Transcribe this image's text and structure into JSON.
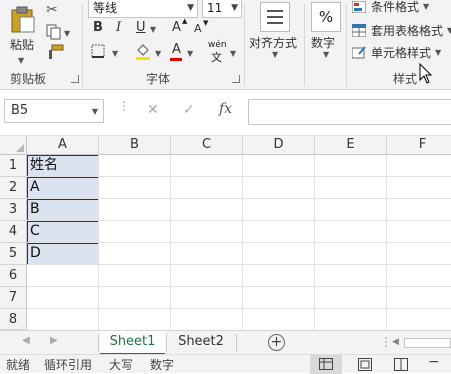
{
  "clipboard": {
    "paste_label": "粘贴",
    "group_label": "剪贴板"
  },
  "font": {
    "font_name": "等线",
    "font_size": "11",
    "bold": "B",
    "italic": "I",
    "underline": "U",
    "grow": "A",
    "shrink": "A",
    "color_a": "A",
    "wen": "wén",
    "wen2": "文",
    "group_label": "字体"
  },
  "alignment": {
    "label": "对齐方式"
  },
  "number": {
    "label": "数字",
    "percent": "%"
  },
  "styles": {
    "conditional": "条件格式",
    "table_format": "套用表格格式",
    "cell_style": "单元格样式",
    "group_label": "样式"
  },
  "formula_bar": {
    "name_box": "B5",
    "fx": "fx",
    "cancel": "✕",
    "enter": "✓"
  },
  "columns": [
    "A",
    "B",
    "C",
    "D",
    "E",
    "F"
  ],
  "rows": [
    "1",
    "2",
    "3",
    "4",
    "5",
    "6",
    "7",
    "8"
  ],
  "cells": {
    "A1": "姓名",
    "A2": "A",
    "A3": "B",
    "A4": "C",
    "A5": "D"
  },
  "sheets": [
    "Sheet1",
    "Sheet2"
  ],
  "status": {
    "ready": "就绪",
    "circular": "循环引用",
    "caps": "大写",
    "num": "数字"
  },
  "colors": {
    "accent": "#217346",
    "selection": "#dbe3f1"
  }
}
